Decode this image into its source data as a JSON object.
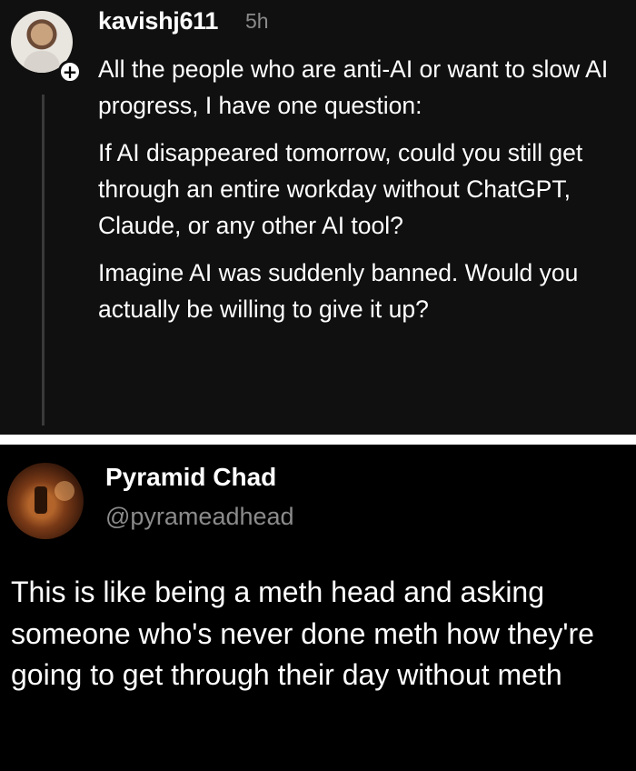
{
  "post1": {
    "username": "kavishj611",
    "time": "5h",
    "paragraphs": [
      "All the people who are anti-AI or want to slow AI progress, I have one question:",
      "If AI disappeared tomorrow, could you still get through an entire workday without ChatGPT, Claude, or any other AI tool?",
      "Imagine AI was suddenly banned. Would you actually be willing to give it up?"
    ],
    "follow_badge": "+"
  },
  "post2": {
    "display_name": "Pyramid Chad",
    "handle": "@pyrameadhead",
    "text": "This is like being a meth head and asking someone who's never done meth how they're going to get through their day without meth"
  },
  "colors": {
    "post1_bg": "#101010",
    "post2_bg": "#000000",
    "separator": "#ffffff",
    "muted": "#8a8a8a"
  }
}
